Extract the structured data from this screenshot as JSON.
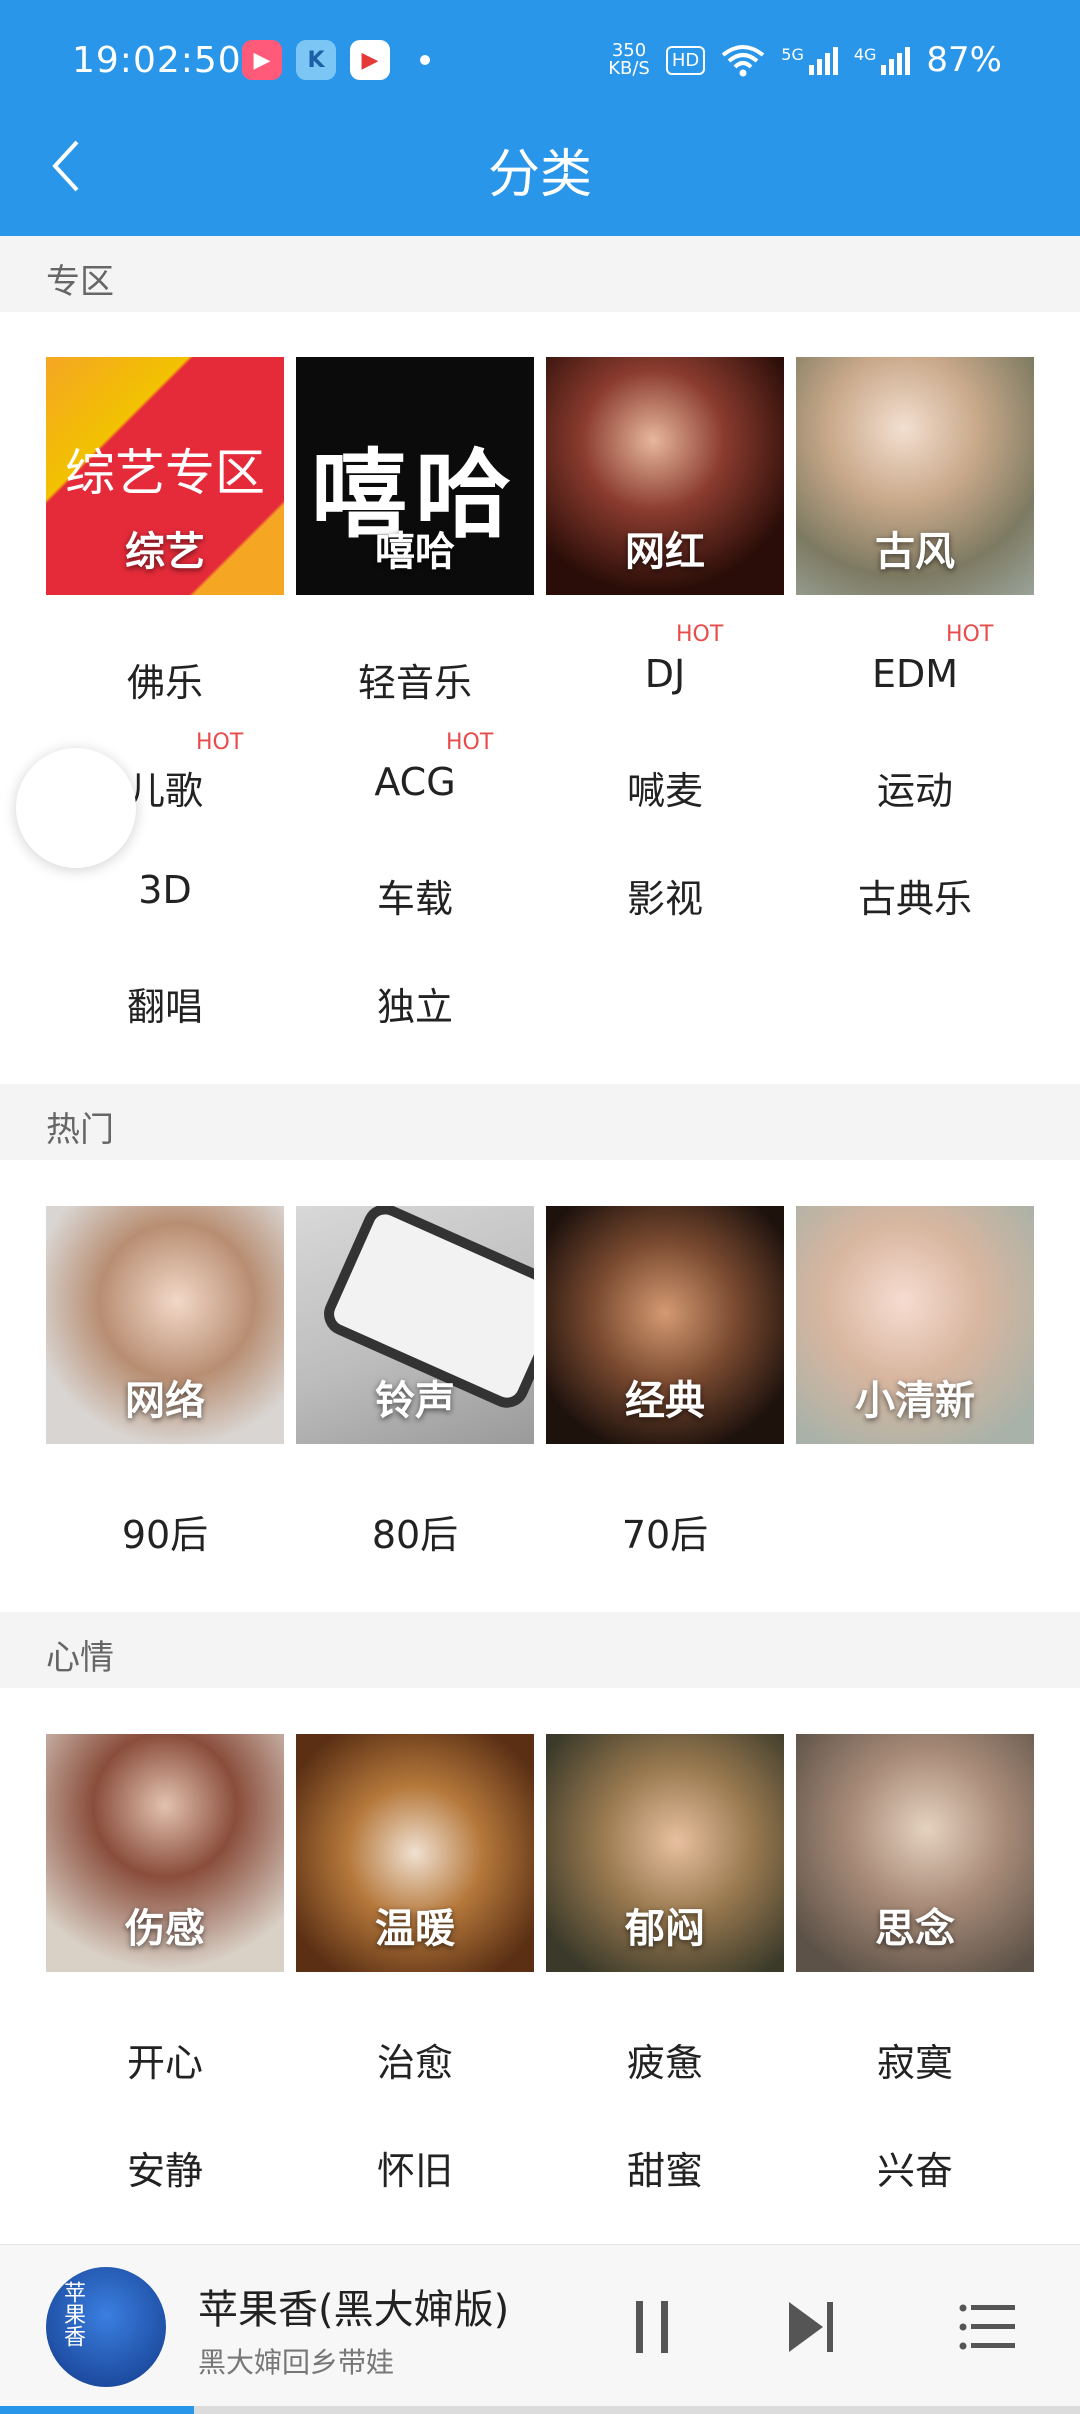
{
  "status_bar": {
    "time": "19:02:50",
    "net_speed_top": "350",
    "net_speed_bottom": "KB/S",
    "hd": "HD",
    "sig1": "5G",
    "sig2": "4G",
    "battery": "87%"
  },
  "header": {
    "title": "分类"
  },
  "sections": {
    "zone": {
      "label": "专区",
      "tiles": [
        {
          "label": "综艺",
          "overtext": "综艺专区"
        },
        {
          "label": "嘻哈",
          "overtext": "嘻哈"
        },
        {
          "label": "网红"
        },
        {
          "label": "古风"
        }
      ],
      "tags": [
        {
          "label": "佛乐"
        },
        {
          "label": "轻音乐"
        },
        {
          "label": "DJ",
          "hot": "HOT"
        },
        {
          "label": "EDM",
          "hot": "HOT"
        },
        {
          "label": "儿歌",
          "hot": "HOT"
        },
        {
          "label": "ACG",
          "hot": "HOT"
        },
        {
          "label": "喊麦"
        },
        {
          "label": "运动"
        },
        {
          "label": "3D"
        },
        {
          "label": "车载"
        },
        {
          "label": "影视"
        },
        {
          "label": "古典乐"
        },
        {
          "label": "翻唱"
        },
        {
          "label": "独立"
        }
      ]
    },
    "hot": {
      "label": "热门",
      "tiles": [
        {
          "label": "网络"
        },
        {
          "label": "铃声"
        },
        {
          "label": "经典"
        },
        {
          "label": "小清新"
        }
      ],
      "tags": [
        {
          "label": "90后"
        },
        {
          "label": "80后"
        },
        {
          "label": "70后"
        }
      ]
    },
    "mood": {
      "label": "心情",
      "tiles": [
        {
          "label": "伤感"
        },
        {
          "label": "温暖"
        },
        {
          "label": "郁闷"
        },
        {
          "label": "思念"
        }
      ],
      "tags": [
        {
          "label": "开心"
        },
        {
          "label": "治愈"
        },
        {
          "label": "疲惫"
        },
        {
          "label": "寂寞"
        },
        {
          "label": "安静"
        },
        {
          "label": "怀旧"
        },
        {
          "label": "甜蜜"
        },
        {
          "label": "兴奋"
        }
      ]
    }
  },
  "player": {
    "song": "苹果香(黑大婶版)",
    "artist": "黑大婶回乡带娃",
    "cover_text": "苹果香",
    "progress": 0.18
  },
  "colors": {
    "accent": "#2a96ea",
    "hot": "#e94b4b"
  }
}
